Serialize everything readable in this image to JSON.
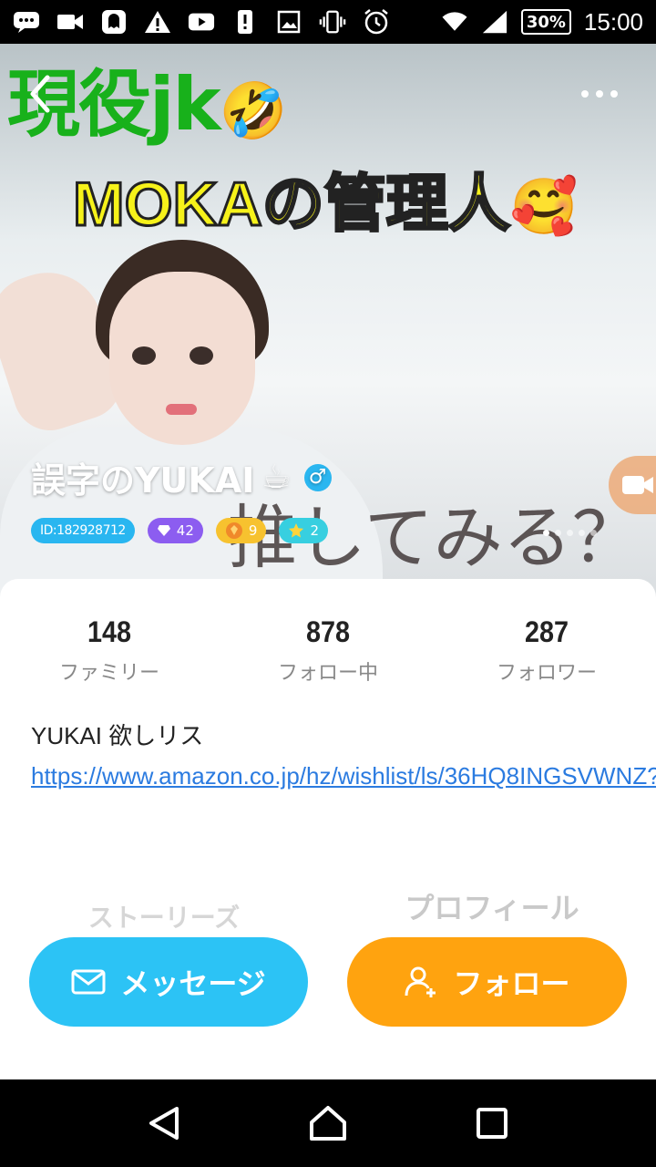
{
  "status_bar": {
    "time": "15:00",
    "battery": "30%",
    "icons": [
      "chat-icon",
      "video-icon",
      "ghost-icon",
      "warning-icon",
      "youtube-icon",
      "alert-icon",
      "image-icon",
      "vibrate-icon",
      "alarm-icon",
      "wifi-icon",
      "signal-icon"
    ]
  },
  "hero": {
    "banner_line1": "現役jk",
    "banner_line2": "MOKAの管理人",
    "scrawl": "推してみる？",
    "emoji_laugh": "🤣",
    "emoji_love": "🥰",
    "emoji_shock": "😳"
  },
  "profile": {
    "username": "誤字のYUKAI",
    "cup_emoji": "☕",
    "gender_symbol": "♂",
    "badges": {
      "id": "ID:182928712",
      "gem": "42",
      "coin": "9",
      "star": "2"
    },
    "carousel_pages": 5,
    "carousel_active": 1
  },
  "stats": [
    {
      "value": "148",
      "label": "ファミリー"
    },
    {
      "value": "878",
      "label": "フォロー中"
    },
    {
      "value": "287",
      "label": "フォロワー"
    }
  ],
  "bio": {
    "text": "YUKAI 欲しリス",
    "link": "https://www.amazon.co.jp/hz/wishlist/ls/36HQ8INGSVWNZ?"
  },
  "tabs": {
    "stories": "ストーリーズ",
    "profile": "プロフィール"
  },
  "actions": {
    "message": "メッセージ",
    "follow": "フォロー"
  },
  "colors": {
    "message_button": "#2cc3f5",
    "follow_button": "#ffa30f",
    "link": "#2b7be0"
  }
}
